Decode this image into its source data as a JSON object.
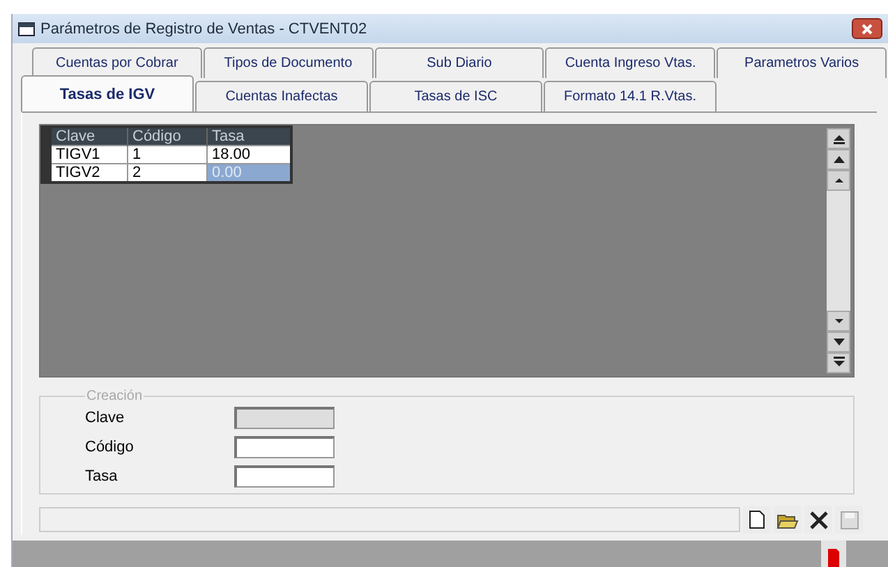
{
  "window": {
    "title": "Parámetros de Registro de Ventas - CTVENT02"
  },
  "tab_rows": [
    {
      "tabs": [
        {
          "label": "Cuentas por Cobrar",
          "selected": false
        },
        {
          "label": "Tipos de Documento",
          "selected": false
        },
        {
          "label": "Sub Diario",
          "selected": false
        },
        {
          "label": "Cuenta Ingreso Vtas.",
          "selected": false
        },
        {
          "label": "Parametros Varios",
          "selected": false
        }
      ]
    },
    {
      "tabs": [
        {
          "label": "Tasas de IGV",
          "selected": true
        },
        {
          "label": "Cuentas Inafectas",
          "selected": false
        },
        {
          "label": "Tasas de ISC",
          "selected": false
        },
        {
          "label": "Formato 14.1 R.Vtas.",
          "selected": false
        }
      ]
    }
  ],
  "grid": {
    "columns": [
      "Clave",
      "Código",
      "Tasa"
    ],
    "rows": [
      {
        "cells": [
          {
            "text": "TIGV1",
            "selected": false
          },
          {
            "text": "1",
            "selected": false
          },
          {
            "text": "18.00",
            "selected": false
          }
        ]
      },
      {
        "cells": [
          {
            "text": "TIGV2",
            "selected": false
          },
          {
            "text": "2",
            "selected": false
          },
          {
            "text": "0.00",
            "selected": true
          }
        ]
      }
    ]
  },
  "creation": {
    "title": "Creación",
    "fields": [
      {
        "label": "Clave",
        "disabled": true
      },
      {
        "label": "Código",
        "disabled": false
      },
      {
        "label": "Tasa",
        "disabled": false
      }
    ]
  }
}
